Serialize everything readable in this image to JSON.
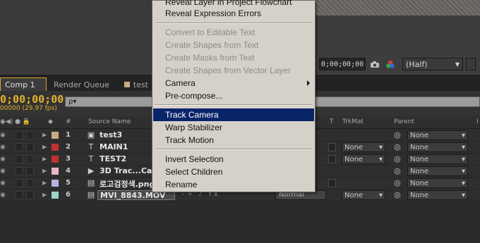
{
  "viewer": {
    "timecode": "0;00;00;00",
    "resolution": "(Half)",
    "snapshot_icon": "camera-icon",
    "channels_icon": "color-channels-icon"
  },
  "tabs": [
    {
      "label": "Comp 1",
      "active": true
    },
    {
      "label": "Render Queue",
      "active": false
    },
    {
      "label": "test",
      "active": false
    }
  ],
  "timeline": {
    "current_time": "0;00;00;00",
    "fps": "00000 (29.97 fps)",
    "search_placeholder": "ρ▾",
    "columns": {
      "num": "#",
      "source_name": "Source Name",
      "t": "T",
      "trkmat": "TrkMat",
      "parent": "Parent",
      "extra": "I"
    },
    "layers": [
      {
        "num": "1",
        "name": "test3",
        "color": "#c8ac80",
        "type_icon": "precomp-icon",
        "trkmat": "",
        "parent": "None"
      },
      {
        "num": "2",
        "name": "MAIN1",
        "color": "#c43030",
        "type_icon": "text-layer-icon",
        "trkmat": "None",
        "parent": "None"
      },
      {
        "num": "3",
        "name": "TEST2",
        "color": "#c43030",
        "type_icon": "text-layer-icon",
        "trkmat": "None",
        "parent": "None"
      },
      {
        "num": "4",
        "name": "3D Trac...Camera",
        "color": "#e8b4c8",
        "type_icon": "camera-layer-icon",
        "trkmat": "",
        "parent": "None"
      },
      {
        "num": "5",
        "name": "로고검정색.png",
        "color": "#b4b4e0",
        "type_icon": "footage-icon",
        "trkmat": "",
        "parent": "None"
      },
      {
        "num": "6",
        "name": "MVI_8843.MOV",
        "color": "#9ed4c8",
        "type_icon": "footage-icon",
        "mode": "Normal",
        "trkmat": "None",
        "parent": "None"
      }
    ]
  },
  "context_menu": {
    "items": [
      {
        "label": "Reveal Layer in Project Flowchart",
        "disabled": false
      },
      {
        "label": "Reveal Expression Errors",
        "disabled": false
      },
      {
        "label": "Convert to Editable Text",
        "disabled": true
      },
      {
        "label": "Create Shapes from Text",
        "disabled": true
      },
      {
        "label": "Create Masks from Text",
        "disabled": true
      },
      {
        "label": "Create Shapes from Vector Layer",
        "disabled": true
      },
      {
        "label": "Camera",
        "disabled": false,
        "submenu": true
      },
      {
        "label": "Pre-compose...",
        "disabled": false
      },
      {
        "label": "Track Camera",
        "disabled": false,
        "selected": true
      },
      {
        "label": "Warp Stabilizer",
        "disabled": false
      },
      {
        "label": "Track Motion",
        "disabled": false
      },
      {
        "label": "Invert Selection",
        "disabled": false
      },
      {
        "label": "Select Children",
        "disabled": false
      },
      {
        "label": "Rename",
        "disabled": false
      }
    ],
    "selected_color": "#0a246a"
  }
}
